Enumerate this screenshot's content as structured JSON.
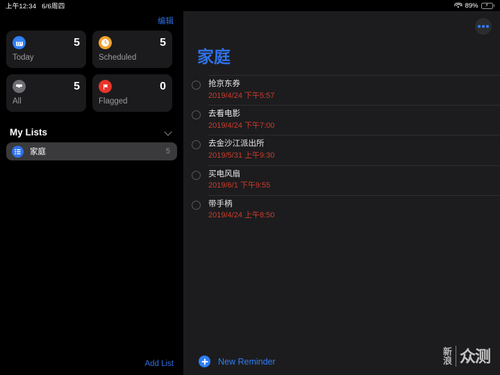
{
  "status_bar": {
    "time": "上午12:34",
    "date": "6/6周四",
    "wifi_icon": "wifi-icon",
    "battery_percent": "89%",
    "battery_icon": "battery-charging-icon",
    "battery_color": "#35c759"
  },
  "sidebar": {
    "edit_label": "编辑",
    "add_list_label": "Add List",
    "accent_color": "#2f6fe0",
    "smart_lists": [
      {
        "label": "Today",
        "count": "5",
        "icon": "calendar-icon",
        "color": "#2f7ef5"
      },
      {
        "label": "Scheduled",
        "count": "5",
        "icon": "clock-icon",
        "color": "#f0a32a"
      },
      {
        "label": "All",
        "count": "5",
        "icon": "inbox-icon",
        "color": "#6d6d72"
      },
      {
        "label": "Flagged",
        "count": "0",
        "icon": "flag-icon",
        "color": "#e8342a"
      }
    ],
    "my_lists": {
      "header": "My Lists",
      "chevron_icon": "chevron-down-icon",
      "items": [
        {
          "name": "家庭",
          "count": "5",
          "icon": "bullet-list-icon",
          "color": "#2f72e8",
          "selected": true
        }
      ]
    }
  },
  "main": {
    "title": "家庭",
    "title_color": "#2f72e8",
    "more_icon": "ellipsis-icon",
    "new_reminder_label": "New Reminder",
    "date_color": "#cf3b2c",
    "reminders": [
      {
        "title": "抢京东券",
        "date": "2019/4/24 下午5:57"
      },
      {
        "title": "去看电影",
        "date": "2019/4/24 下午7:00"
      },
      {
        "title": "去金沙江派出所",
        "date": "2019/5/31 上午9:30"
      },
      {
        "title": "买电风扇",
        "date": "2019/6/1 下午9:55"
      },
      {
        "title": "带手柄",
        "date": "2019/4/24 上午8:50"
      }
    ]
  },
  "watermark": {
    "left_line1": "新",
    "left_line2": "浪",
    "right": "众测"
  }
}
